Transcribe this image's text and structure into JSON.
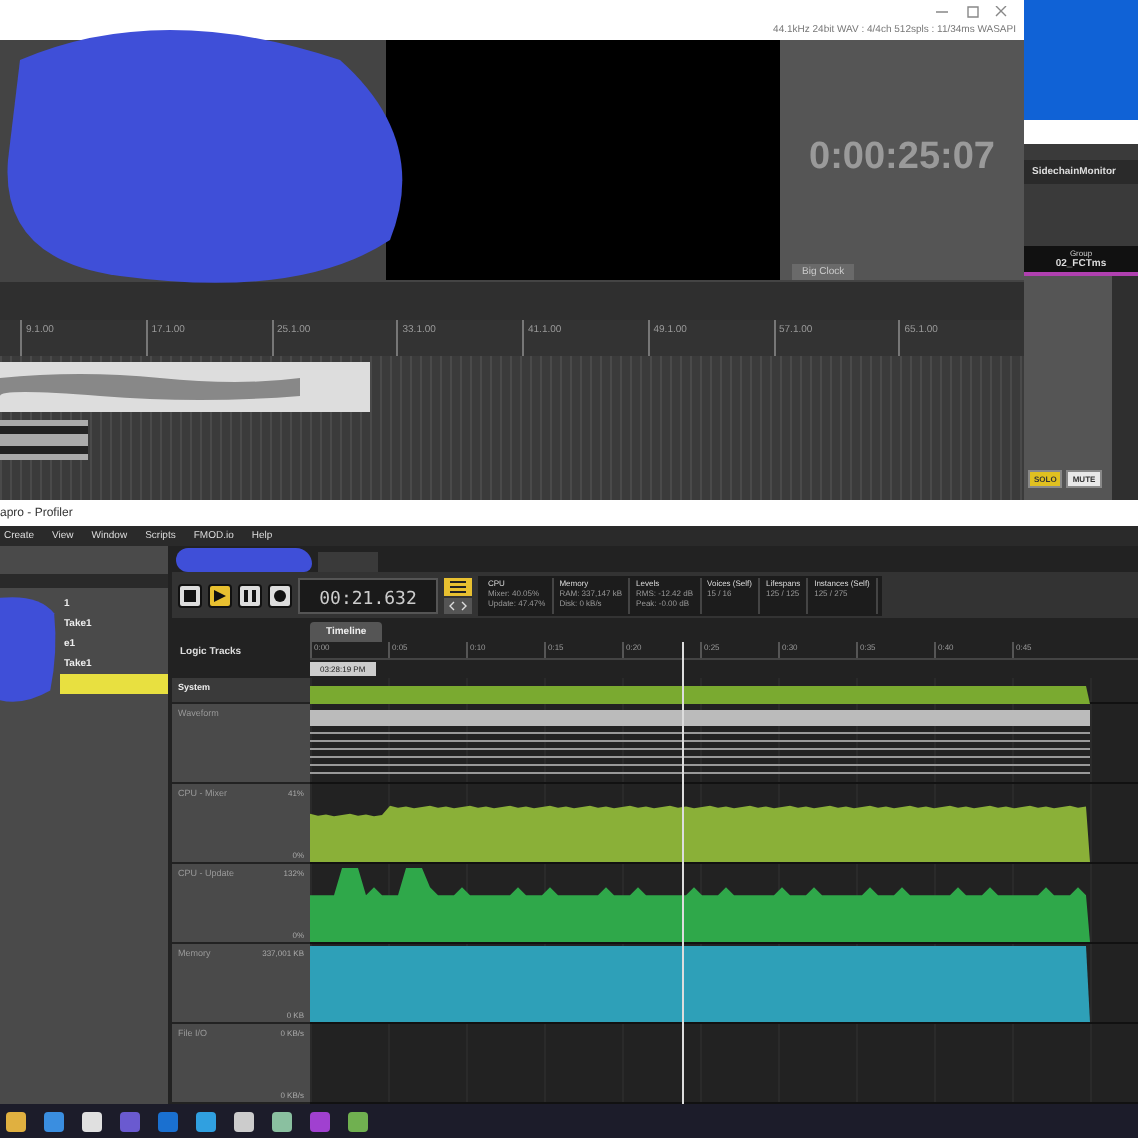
{
  "editor": {
    "status": "44.1kHz 24bit WAV : 4/4ch 512spls : 11/34ms WASAPI",
    "clock": "0:00:25:07",
    "clock_tab": "Big Clock",
    "ruler": [
      "9.1.00",
      "17.1.00",
      "25.1.00",
      "33.1.00",
      "41.1.00",
      "49.1.00",
      "57.1.00",
      "65.1.00"
    ],
    "mixer": {
      "title": "SidechainMonitor",
      "group_label": "Group",
      "group_name": "02_FCTms",
      "buttons": [
        {
          "label": "SOLO",
          "on": true
        },
        {
          "label": "MUTE",
          "on": false
        }
      ]
    }
  },
  "profiler": {
    "title": "apro - Profiler",
    "menu": [
      "Create",
      "View",
      "Window",
      "Scripts",
      "FMOD.io",
      "Help"
    ],
    "left_items": [
      {
        "label": "1",
        "selected": false
      },
      {
        "label": "Take1",
        "selected": false
      },
      {
        "label": "e1",
        "selected": false
      },
      {
        "label": "Take1",
        "selected": false
      },
      {
        "selected": true
      }
    ],
    "transport": [
      {
        "kind": "stop",
        "on": false
      },
      {
        "kind": "play",
        "on": true
      },
      {
        "kind": "pause",
        "on": false
      },
      {
        "kind": "record",
        "on": false
      }
    ],
    "time": "00:21.632",
    "stats": [
      {
        "title": "CPU",
        "lines": [
          "Mixer: 40.05%",
          "Update: 47.47%"
        ]
      },
      {
        "title": "Memory",
        "lines": [
          "RAM: 337,147 kB",
          "Disk: 0 kB/s"
        ]
      },
      {
        "title": "Levels",
        "lines": [
          "RMS: -12.42 dB",
          "Peak: -0.00 dB"
        ]
      },
      {
        "title": "Voices (Self)",
        "lines": [
          "15 / 16"
        ]
      },
      {
        "title": "Lifespans",
        "lines": [
          "125 / 125"
        ]
      },
      {
        "title": "Instances (Self)",
        "lines": [
          "125 / 275"
        ]
      }
    ],
    "tab": "Timeline",
    "logic_label": "Logic Tracks",
    "ticks": [
      "0:00",
      "0:05",
      "0:10",
      "0:15",
      "0:20",
      "0:25",
      "0:30",
      "0:35",
      "0:40",
      "0:45"
    ],
    "marker": "03:28:19 PM",
    "tracks": [
      {
        "name": "System",
        "kind": "system"
      },
      {
        "name": "Waveform",
        "kind": "waveform"
      },
      {
        "name": "CPU - Mixer",
        "kind": "mixer",
        "max": "41%",
        "min": "0%"
      },
      {
        "name": "CPU - Update",
        "kind": "update",
        "max": "132%",
        "min": "0%"
      },
      {
        "name": "Memory",
        "kind": "memory",
        "max": "337,001 KB",
        "min": "0 KB"
      },
      {
        "name": "File I/O",
        "kind": "file",
        "max": "0 KB/s",
        "min": "0 KB/s"
      }
    ]
  }
}
